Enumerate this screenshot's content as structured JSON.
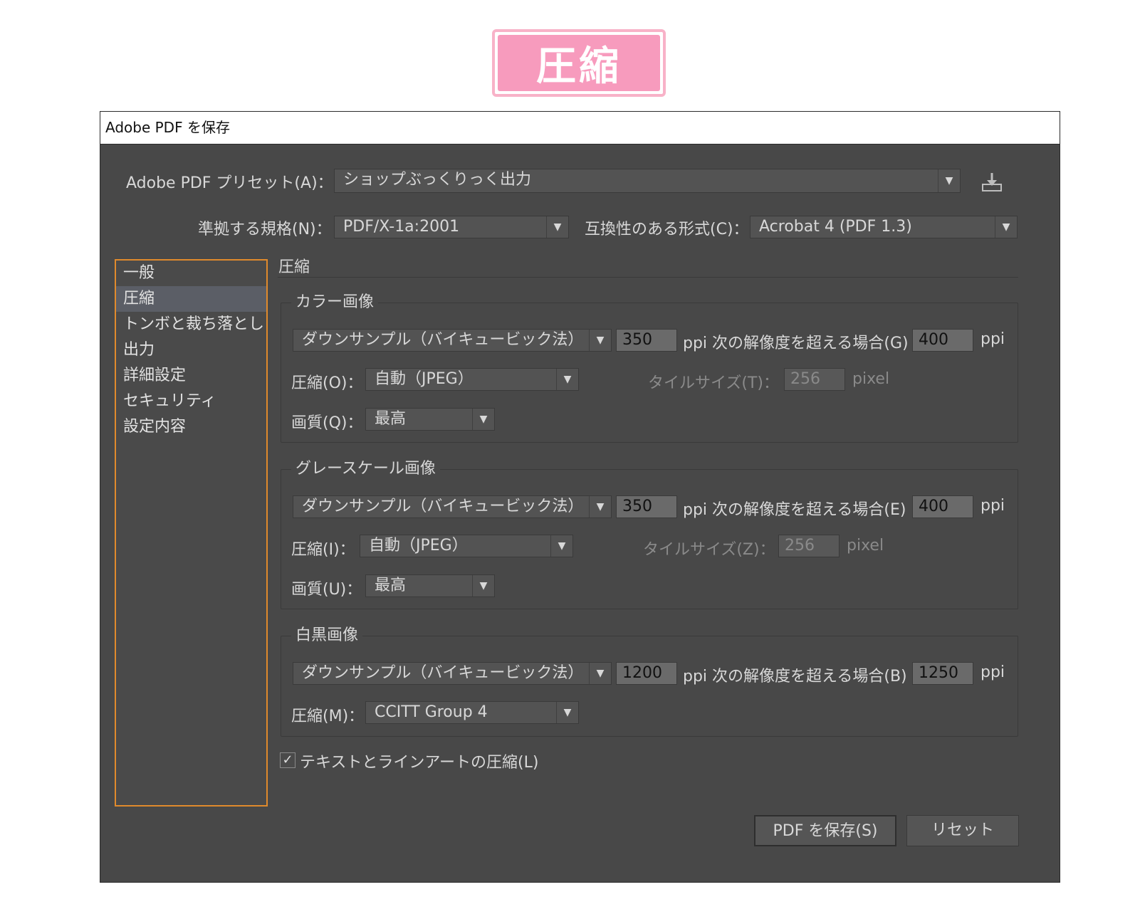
{
  "banner": {
    "text": "圧縮",
    "color": "#f79bbd"
  },
  "dialog": {
    "title": "Adobe PDF を保存",
    "preset_label": "Adobe  PDF プリセット(A)：",
    "preset_value": "ショップぶっくりっく出力",
    "standard_label": "準拠する規格(N)：",
    "standard_value": "PDF/X-1a:2001",
    "compat_label": "互換性のある形式(C)：",
    "compat_value": "Acrobat 4 (PDF 1.3)",
    "sidebar": [
      {
        "label": "一般"
      },
      {
        "label": "圧縮"
      },
      {
        "label": "トンボと裁ち落とし"
      },
      {
        "label": "出力"
      },
      {
        "label": "詳細設定"
      },
      {
        "label": "セキュリティ"
      },
      {
        "label": "設定内容"
      }
    ],
    "section_title": "圧縮",
    "color": {
      "title": "カラー画像",
      "downsample": "ダウンサンプル（バイキュービック法）",
      "ppi1": "350",
      "ppi_label": "ppi  次の解像度を超える場合(G)",
      "ppi2": "400",
      "ppi_unit": "ppi",
      "comp_label": "圧縮(O)：",
      "comp_value": "自動（JPEG）",
      "tile_label": "タイルサイズ(T)：",
      "tile_value": "256",
      "tile_unit": "pixel",
      "quality_label": "画質(Q)：",
      "quality_value": "最高"
    },
    "gray": {
      "title": "グレースケール画像",
      "downsample": "ダウンサンプル（バイキュービック法）",
      "ppi1": "350",
      "ppi_label": "ppi  次の解像度を超える場合(E)",
      "ppi2": "400",
      "ppi_unit": "ppi",
      "comp_label": "圧縮(I)：",
      "comp_value": "自動（JPEG）",
      "tile_label": "タイルサイズ(Z)：",
      "tile_value": "256",
      "tile_unit": "pixel",
      "quality_label": "画質(U)：",
      "quality_value": "最高"
    },
    "mono": {
      "title": "白黒画像",
      "downsample": "ダウンサンプル（バイキュービック法）",
      "ppi1": "1200",
      "ppi_label": "ppi  次の解像度を超える場合(B)",
      "ppi2": "1250",
      "ppi_unit": "ppi",
      "comp_label": "圧縮(M)：",
      "comp_value": "CCITT Group 4"
    },
    "text_compress": {
      "checked": true,
      "label": "テキストとラインアートの圧縮(L)"
    },
    "save_button": "PDF を保存(S)",
    "reset_button": "リセット"
  }
}
